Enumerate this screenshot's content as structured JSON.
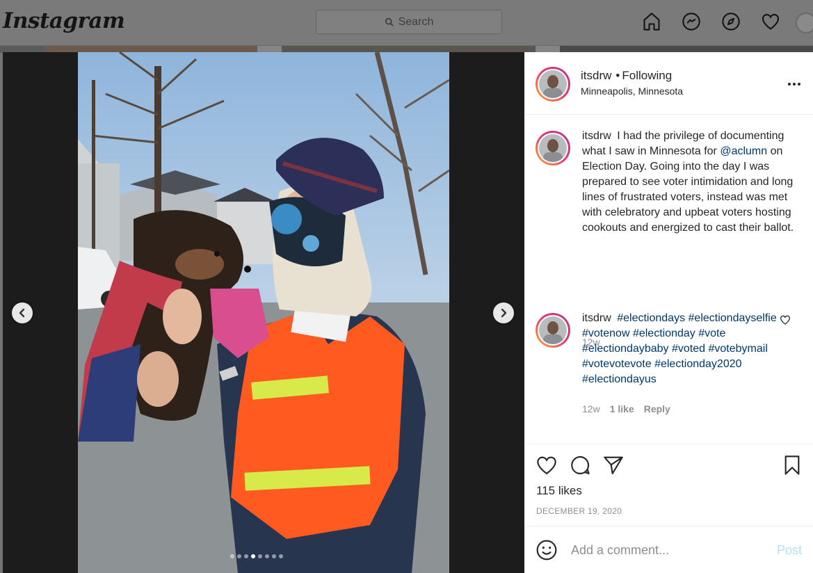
{
  "nav": {
    "logo": "Instagram",
    "search_placeholder": "Search",
    "icons": [
      "home-icon",
      "messenger-icon",
      "explore-icon",
      "heart-icon",
      "avatar"
    ]
  },
  "post": {
    "username": "itsdrw",
    "follow_status": "Following",
    "location": "Minneapolis, Minnesota",
    "carousel": {
      "count": 8,
      "active_index": 4
    },
    "caption": {
      "username": "itsdrw",
      "text_before": "I had the privilege of documenting what I saw in Minnesota for",
      "mention": "@aclumn",
      "text_after": "on Election Day. Going into the day I was prepared to see voter intimidation and long lines of frustrated voters, instead was met with celebratory and upbeat voters hosting cookouts and energized to cast their ballot.",
      "time": "12w"
    },
    "comment": {
      "username": "itsdrw",
      "hashtags": [
        "#electiondays",
        "#electiondayselfie",
        "#votenow",
        "#electionday",
        "#vote",
        "#electiondaybaby",
        "#voted",
        "#votebymail",
        "#votevotevote",
        "#electionday2020",
        "#electiondayus"
      ],
      "time": "12w",
      "likes": "1 like",
      "reply": "Reply"
    },
    "likes": "115 likes",
    "date": "DECEMBER 19, 2020",
    "add_comment_placeholder": "Add a comment...",
    "post_button": "Post"
  },
  "colors": {
    "link": "#00376b",
    "muted": "#8e8e8e",
    "post_disabled": "#b2dffc"
  }
}
